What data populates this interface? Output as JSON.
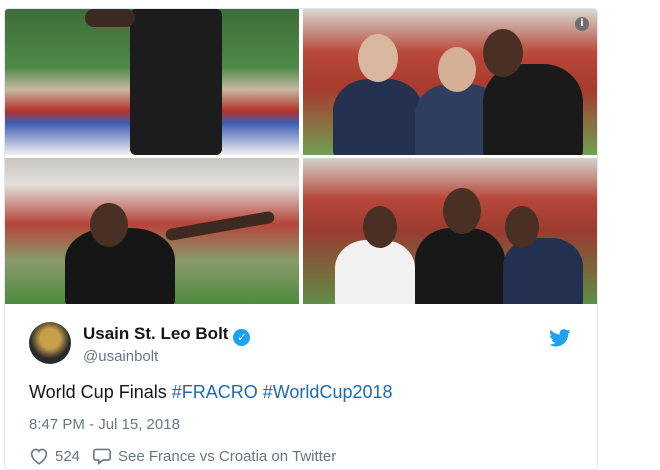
{
  "photos": [
    {
      "alt": "photo-1"
    },
    {
      "alt": "photo-2"
    },
    {
      "alt": "photo-3"
    },
    {
      "alt": "photo-4"
    }
  ],
  "tweet": {
    "display_name": "Usain St. Leo Bolt",
    "verified_glyph": "✓",
    "handle": "@usainbolt",
    "text_plain": "World Cup Finals ",
    "hashtag_1": "#FRACRO",
    "hashtag_2": "#WorldCup2018",
    "timestamp": "8:47 PM - Jul 15, 2018",
    "like_count": "524",
    "see_link": "See France vs Croatia on Twitter"
  },
  "info_glyph": "i",
  "colors": {
    "twitter_blue": "#1da1f2",
    "hashtag": "#1b6bb3",
    "secondary_text": "#657786"
  },
  "icons": [
    "info-icon",
    "verified-icon",
    "twitter-bird-icon",
    "heart-icon",
    "comment-icon"
  ]
}
